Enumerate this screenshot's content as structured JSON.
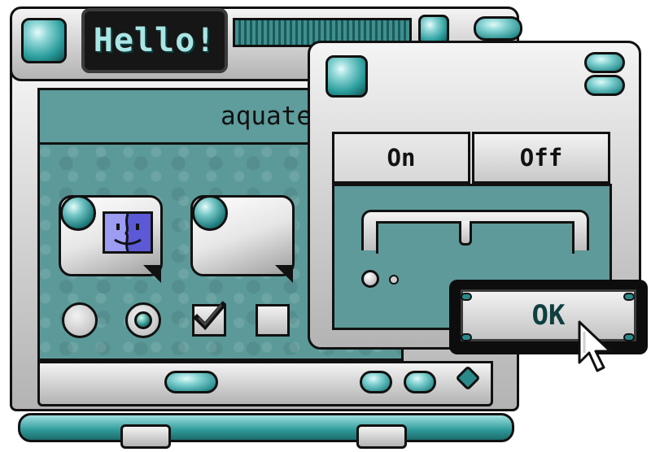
{
  "main_window": {
    "title": "Hello!",
    "app_label": "aquatech 1.0"
  },
  "dialog": {
    "segments": [
      {
        "label": "On",
        "selected": true
      },
      {
        "label": "Off",
        "selected": false
      }
    ],
    "ok_label": "OK"
  },
  "colors": {
    "accent_teal": "#5c9a9a",
    "title_text": "#a9e5e3",
    "finder_blue": "#5b59d6"
  },
  "icons": [
    "finder-icon",
    "radio-button",
    "checkbox",
    "cursor-arrow"
  ]
}
